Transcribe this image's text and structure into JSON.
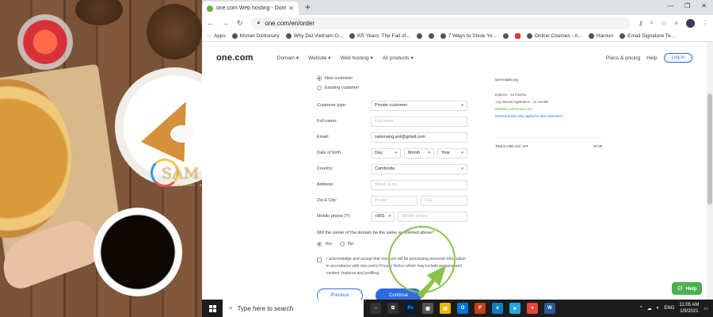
{
  "brand_overlay": {
    "name": "SAM INSPIRE",
    "tagline": "EMERGING · BUILDING · EMPOWERING"
  },
  "browser": {
    "tab_title": "one.com Web hosting - Domai",
    "url": "one.com/en/order",
    "bookmarks": [
      {
        "icon": "apps-grid-icon",
        "label": "Apps"
      },
      {
        "icon": "globe-icon",
        "label": "Khmer Dictionary"
      },
      {
        "icon": "site-icon",
        "label": "Why Did Vietnam O..."
      },
      {
        "icon": "site-icon",
        "label": "KR Years: The Fall of..."
      },
      {
        "icon": "globe-icon",
        "label": ""
      },
      {
        "icon": "globe-icon",
        "label": ""
      },
      {
        "icon": "site-icon",
        "label": "7 Ways to Show Yo..."
      },
      {
        "icon": "globe-icon",
        "label": ""
      },
      {
        "icon": "youtube-icon",
        "label": ""
      },
      {
        "icon": "site-icon",
        "label": "Online Courses - A..."
      },
      {
        "icon": "globe-icon",
        "label": "Haroun"
      },
      {
        "icon": "site-icon",
        "label": "Email Signature Te..."
      }
    ]
  },
  "site": {
    "logo": "one.com",
    "nav": [
      "Domain",
      "Website",
      "Web hosting",
      "All products"
    ],
    "nav_right": {
      "plans": "Plans & pricing",
      "help": "Help",
      "login": "Log in"
    }
  },
  "form": {
    "customer_options": [
      "New customer",
      "Existing customer"
    ],
    "fields": {
      "customer_type": {
        "label": "Customer type:",
        "value": "Private customer"
      },
      "full_name": {
        "label": "Full name:",
        "placeholder": "Full name"
      },
      "email": {
        "label": "Email:",
        "value": "sammang.ant@gmail.com"
      },
      "dob": {
        "label": "Date of birth:",
        "day": "Day",
        "month": "Month",
        "year": "Year"
      },
      "country": {
        "label": "Country:",
        "value": "Cambodia"
      },
      "address": {
        "label": "Address:",
        "placeholder": "Street & no."
      },
      "zip_city": {
        "label": "Zip & City:",
        "zip_placeholder": "Postal",
        "city_placeholder": "City"
      },
      "mobile": {
        "label": "Mobile phone (?):",
        "code": "+855",
        "placeholder": "Mobile phone"
      }
    },
    "owner_question": "Will the owner of the domain be the same as entered above?",
    "yes_label": "Yes",
    "no_label": "No",
    "consent_pre": "I acknowledge and accept that one.com will be processing personal information in accordance with one.com's ",
    "consent_link": "Privacy Notice",
    "consent_post": " which may include personalised content, features and profiling.",
    "previous_label": "Previous",
    "continue_label": "Continue"
  },
  "summary": {
    "domain": "sam-inspire.org",
    "lines": [
      "Explorer - 12 months",
      ".org domain registration - 12 months"
    ],
    "green_line": "Website performance pro",
    "blue_line": "Referral bonus only applied to new customers",
    "total_label": "Total in USD excl. VAT",
    "total_value": "87.89"
  },
  "help_label": "Help",
  "taskbar": {
    "search_placeholder": "Type here to search",
    "language": "ENG",
    "time": "11:05 AM",
    "date": "1/9/2021"
  },
  "colors": {
    "accent": "#2d6cdf",
    "help_green": "#4caf50",
    "annotation_green": "#8bc34a"
  }
}
